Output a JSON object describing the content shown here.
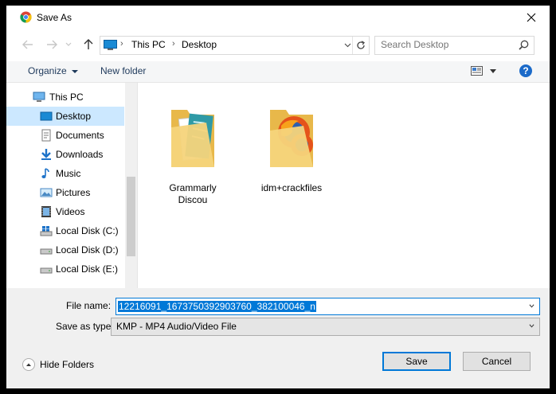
{
  "window": {
    "title": "Save As"
  },
  "nav": {
    "breadcrumbs": [
      "This PC",
      "Desktop"
    ],
    "search_placeholder": "Search Desktop"
  },
  "toolbar": {
    "organize": "Organize",
    "new_folder": "New folder",
    "help": "?"
  },
  "sidebar": {
    "items": [
      {
        "label": "This PC",
        "icon": "computer-icon"
      },
      {
        "label": "Desktop",
        "icon": "desktop-folder-icon",
        "selected": true
      },
      {
        "label": "Documents",
        "icon": "documents-icon"
      },
      {
        "label": "Downloads",
        "icon": "downloads-icon"
      },
      {
        "label": "Music",
        "icon": "music-icon"
      },
      {
        "label": "Pictures",
        "icon": "pictures-icon"
      },
      {
        "label": "Videos",
        "icon": "videos-icon"
      },
      {
        "label": "Local Disk (C:)",
        "icon": "system-drive-icon"
      },
      {
        "label": "Local Disk (D:)",
        "icon": "drive-icon"
      },
      {
        "label": "Local Disk (E:)",
        "icon": "drive-icon"
      }
    ]
  },
  "files": [
    {
      "name_line1": "Grammarly",
      "name_line2": "Discou",
      "icon": "folder-icon"
    },
    {
      "name_line1": "idm+crackfiles",
      "name_line2": "",
      "icon": "folder-firefox-icon"
    }
  ],
  "form": {
    "file_name_label": "File name:",
    "file_name_value": "12216091_1673750392903760_382100046_n",
    "save_type_label": "Save as type:",
    "save_type_value": "KMP - MP4 Audio/Video File",
    "hide_folders": "Hide Folders",
    "save": "Save",
    "cancel": "Cancel"
  },
  "colors": {
    "accent": "#0078d7",
    "selection": "#cce8ff",
    "link": "#1e395b"
  }
}
